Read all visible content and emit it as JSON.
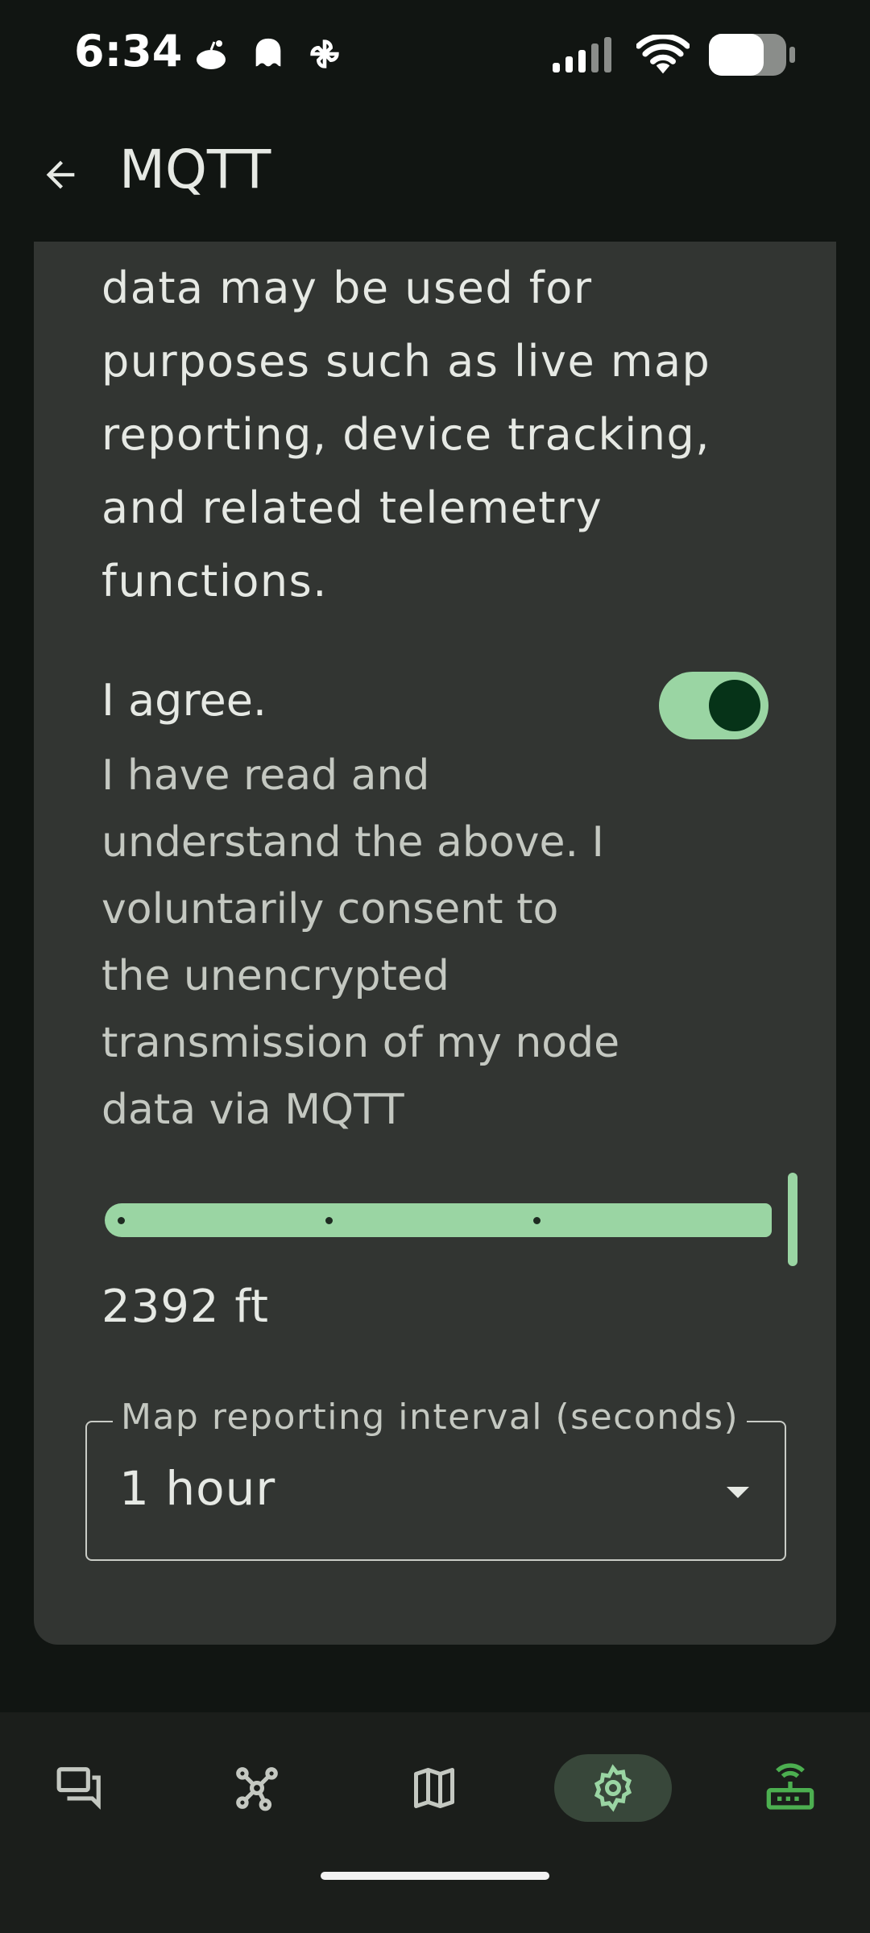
{
  "status_bar": {
    "time": "6:34",
    "notification_icons": [
      "reddit-icon",
      "ghost-icon",
      "pinwheel-icon"
    ],
    "system_icons": [
      "signal-icon",
      "wifi-icon",
      "battery-icon"
    ]
  },
  "app_bar": {
    "back_icon": "arrow-left-icon",
    "title": "MQTT"
  },
  "card": {
    "body_lines": [
      "data may be used for",
      "purposes such as live map",
      "reporting, device tracking,",
      "and related telemetry",
      "functions."
    ],
    "agree": {
      "title": "I agree.",
      "description_lines": [
        "I have read and",
        "understand the above. I",
        "voluntarily consent to",
        "the unencrypted",
        "transmission of my node",
        "data via MQTT"
      ],
      "toggle_on": true
    },
    "slider": {
      "value_fraction": 1.0,
      "value_label": "2392 ft"
    },
    "interval_field": {
      "label": "Map reporting interval (seconds)",
      "value": "1 hour"
    }
  },
  "bottom_nav": {
    "items": [
      {
        "icon": "chat-icon",
        "active": false
      },
      {
        "icon": "nodes-icon",
        "active": false
      },
      {
        "icon": "map-icon",
        "active": false
      },
      {
        "icon": "gear-icon",
        "active": true
      },
      {
        "icon": "router-icon",
        "active": false
      }
    ]
  },
  "colors": {
    "accent": "#9ad5a3",
    "background": "#111512",
    "card": "#323532",
    "router_icon": "#4caf50"
  }
}
